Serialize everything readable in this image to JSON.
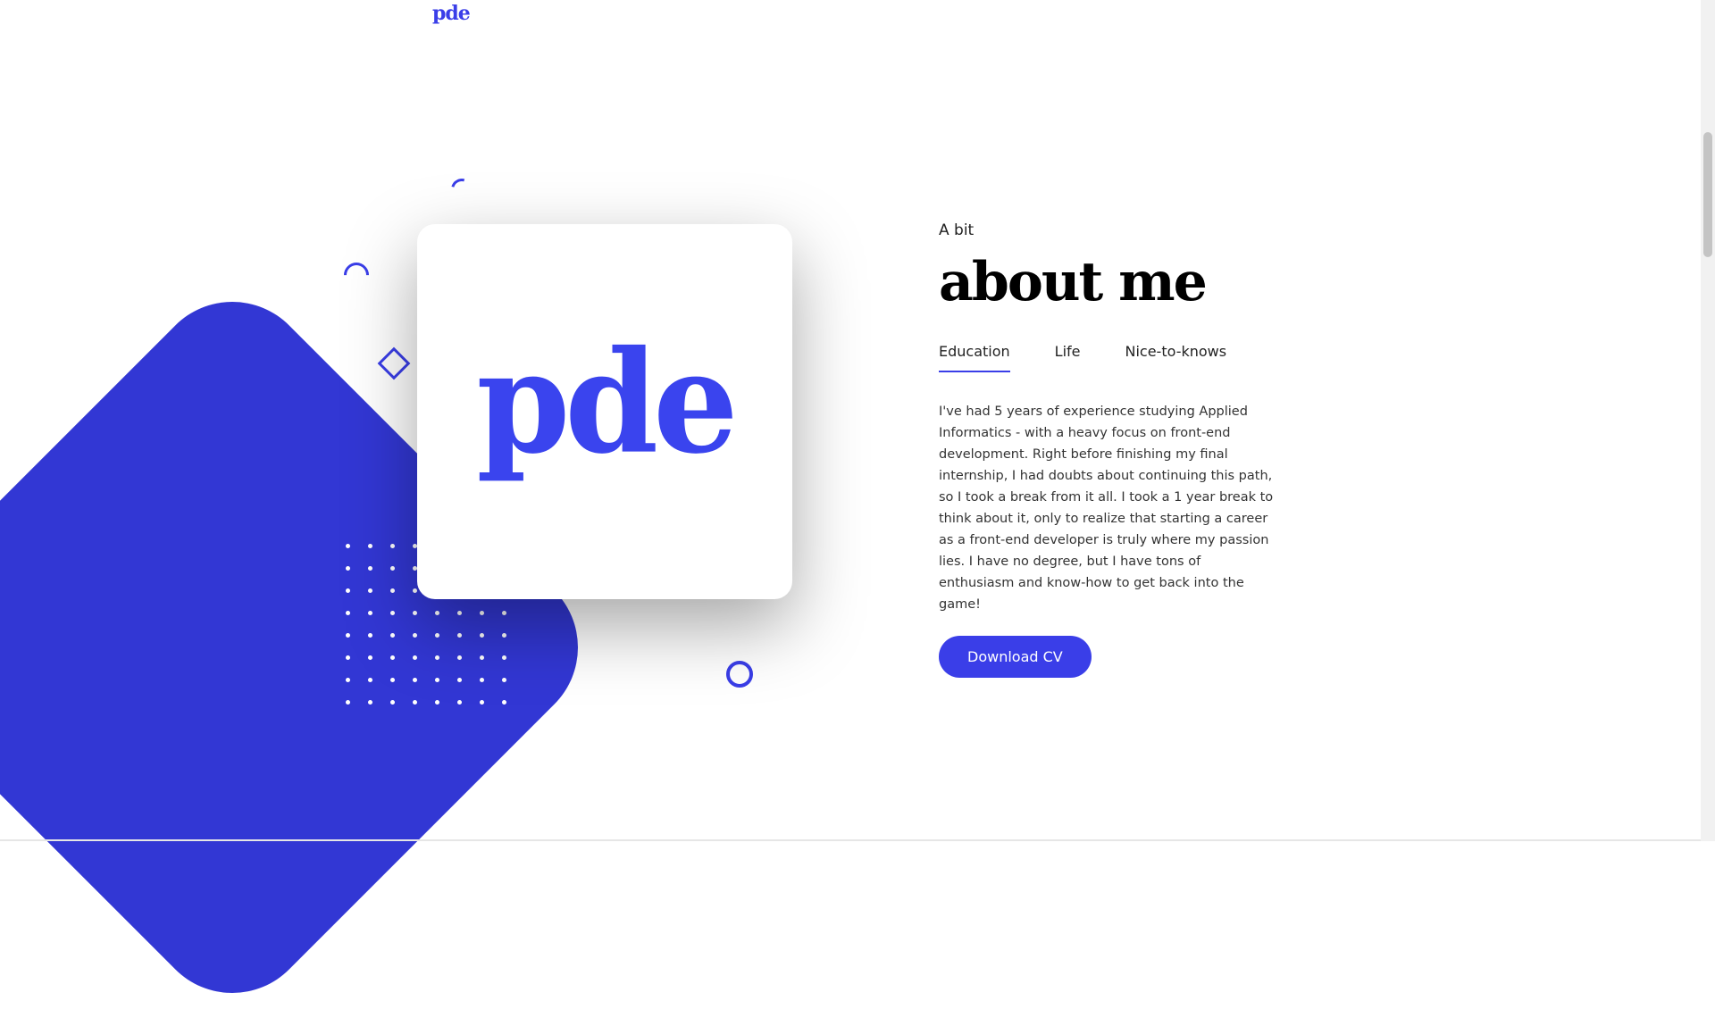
{
  "header": {
    "logo": "pde"
  },
  "hero": {
    "card_logo": "pde"
  },
  "about": {
    "eyebrow": "A bit",
    "title": "about me",
    "tabs": [
      {
        "label": "Education",
        "active": true
      },
      {
        "label": "Life",
        "active": false
      },
      {
        "label": "Nice-to-knows",
        "active": false
      }
    ],
    "body": "I've had 5 years of experience studying Applied Informatics - with a heavy focus on front-end development. Right before finishing my final internship, I had doubts about continuing this path, so I took a break from it all. I took a 1 year break to think about it, only to realize that starting a career as a front-end developer is truly where my passion lies. I have no degree, but I have tons of enthusiasm and know-how to get back into the game!",
    "cta_label": "Download CV"
  },
  "colors": {
    "accent": "#3a3ee8",
    "blob": "#3237d4"
  }
}
